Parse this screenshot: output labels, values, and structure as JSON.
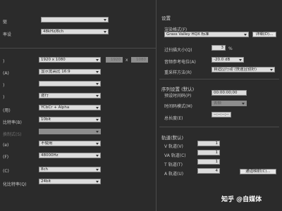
{
  "left": {
    "row1": {
      "label": "驱",
      "value": ""
    },
    "row2": {
      "label": "率设",
      "value": "48kHz/8ch"
    },
    "row3": {
      "label": "",
      "value": "1920 x 1080",
      "w": "1920",
      "x": "x",
      "h": "1080"
    },
    "row4": {
      "label": "",
      "value": "显示宽高比 16:9"
    },
    "row5": {
      "label": "",
      "value": ""
    },
    "row6": {
      "label": "",
      "value": "逐行"
    },
    "row7": {
      "label": "",
      "value": "YCbCr + Alpha"
    },
    "row8": {
      "label": "",
      "value": "10bit"
    },
    "row9": {
      "label": "",
      "value": ""
    },
    "row10": {
      "label": "",
      "value": "不使用"
    },
    "row11": {
      "label": "",
      "value": "48000Hz"
    },
    "row12": {
      "label": "",
      "value": "8ch"
    },
    "row13": {
      "label": "",
      "value": "24bit"
    }
  },
  "settings": {
    "title": "设置",
    "render_format_label": "渲染格式(F)",
    "render_format_value": "Grass Valley HQX 标准",
    "details_button": "详细(D)...",
    "max_size_label": "过扫描大小(Q)",
    "max_size_value": "3",
    "max_size_unit": "%",
    "audio_ref_label": "音频参考电位(A)",
    "audio_ref_value": "-20.0 dB",
    "resample_label": "重采样方法(R)",
    "resample_value": "自适应行动 (快速且较好)"
  },
  "sequence": {
    "title": "序列设置 (默认)",
    "timecode_label": "预设时间码(P)",
    "timecode_value": "00:00:00;00",
    "mode_label": "时间码模式(M)",
    "mode_value": "丢帧",
    "total_length_label": "总长度(E)",
    "total_length_value": "--:--:--;--"
  },
  "tracks": {
    "title": "轨道(默认)",
    "v_label": "V 轨道(V)",
    "v_value": "1",
    "va_label": "VA 轨道(C)",
    "va_value": "1",
    "t_label": "T 轨道(T)",
    "t_value": "1",
    "a_label": "A 轨道(U)",
    "a_value": "4",
    "mapping_button": "通道映射(C)..."
  },
  "watermark": {
    "text": "知乎 @自媒体"
  }
}
